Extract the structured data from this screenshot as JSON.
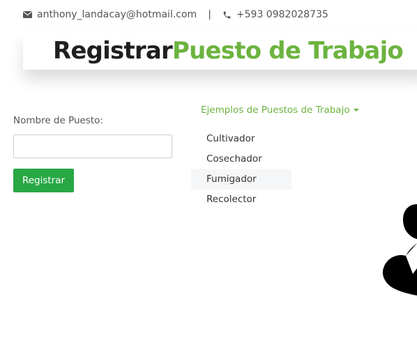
{
  "contact": {
    "email": "anthony_landacay@hotmail.com",
    "separator": "|",
    "phone": "+593 0982028735"
  },
  "header": {
    "title_part1": "Registrar",
    "title_part2": "Puesto de Trabajo"
  },
  "form": {
    "label": "Nombre de Puesto:",
    "input_value": "",
    "submit_label": "Registrar"
  },
  "examples": {
    "toggle_label": "Ejemplos de Puestos de Trabajo",
    "items": [
      {
        "label": "Cultivador"
      },
      {
        "label": "Cosechador"
      },
      {
        "label": "Fumigador"
      },
      {
        "label": "Recolector"
      }
    ],
    "highlighted_item": "Fumigador"
  },
  "colors": {
    "accent_green": "#6cb33f",
    "button_green": "#28a745",
    "title_dark": "#1f1f1f"
  },
  "icons": [
    "envelope-icon",
    "phone-icon",
    "caret-down-icon",
    "user-silhouette-icon"
  ]
}
